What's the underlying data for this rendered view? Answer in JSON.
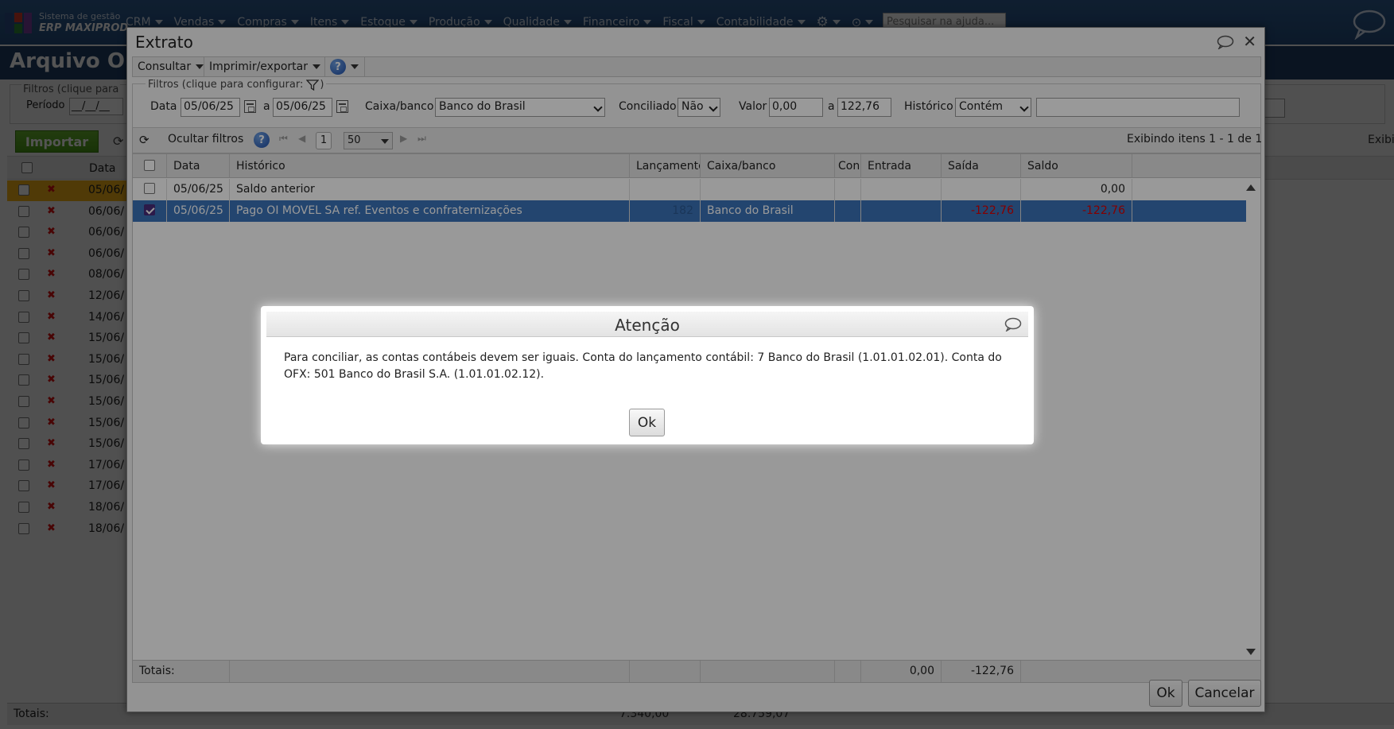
{
  "topbar": {
    "logo_line1": "Sistema de gestão",
    "logo_line2": "ERP MAXIPROD",
    "menu": [
      "CRM",
      "Vendas",
      "Compras",
      "Itens",
      "Estoque",
      "Produção",
      "Qualidade",
      "Financeiro",
      "Fiscal",
      "Contabilidade"
    ],
    "help_search_placeholder": "Pesquisar na ajuda..."
  },
  "background": {
    "page_title": "Arquivo OFX",
    "filter_legend": "Filtros (clique para",
    "periodo_label": "Período",
    "periodo_value": "__/__/__",
    "importar_label": "Importar",
    "exibi_text": "Exibi",
    "col_data": "Data",
    "rows": [
      {
        "date": "05/06/"
      },
      {
        "date": "06/06/"
      },
      {
        "date": "06/06/"
      },
      {
        "date": "06/06/"
      },
      {
        "date": "08/06/"
      },
      {
        "date": "12/06/"
      },
      {
        "date": "14/06/"
      },
      {
        "date": "15/06/"
      },
      {
        "date": "15/06/"
      },
      {
        "date": "15/06/"
      },
      {
        "date": "15/06/"
      },
      {
        "date": "15/06/"
      },
      {
        "date": "15/06/"
      },
      {
        "date": "17/06/"
      },
      {
        "date": "17/06/"
      },
      {
        "date": "18/06/"
      },
      {
        "date": "18/06/"
      }
    ],
    "totais_label": "Totais:",
    "totais_v1": "7.340,00",
    "totais_v2": "28.759,07"
  },
  "extrato": {
    "title": "Extrato",
    "toolbar": {
      "consultar": "Consultar",
      "imprimir": "Imprimir/exportar"
    },
    "filters": {
      "legend": "Filtros (clique para configurar:",
      "legend_end": ")",
      "data_label": "Data",
      "data_from": "05/06/25",
      "a_label": "a",
      "data_to": "05/06/25",
      "caixa_label": "Caixa/banco",
      "caixa_value": "Banco do Brasil",
      "conciliado_label": "Conciliado",
      "conciliado_value": "Não",
      "valor_label": "Valor",
      "valor_from": "0,00",
      "valor_to": "122,76",
      "historico_label": "Histórico",
      "historico_op": "Contém",
      "historico_value": ""
    },
    "gridbar": {
      "ocultar_filtros": "Ocultar filtros",
      "page": "1",
      "per_page": "50",
      "exibindo": "Exibindo itens 1 - 1 de 1"
    },
    "columns": [
      "Data",
      "Histórico",
      "Lançamento",
      "Caixa/banco",
      "Conc",
      "Entrada",
      "Saída",
      "Saldo"
    ],
    "rows": [
      {
        "data": "05/06/25",
        "historico": "Saldo anterior",
        "lancamento": "",
        "caixa": "",
        "entrada": "",
        "saida": "",
        "saldo": "0,00",
        "checked": false
      },
      {
        "data": "05/06/25",
        "historico": "Pago OI MOVEL SA ref. Eventos e confraternizações",
        "lancamento": "182",
        "caixa": "Banco do Brasil",
        "entrada": "",
        "saida": "-122,76",
        "saldo": "-122,76",
        "checked": true
      }
    ],
    "totais_label": "Totais:",
    "totais_entrada": "0,00",
    "totais_saida": "-122,76",
    "ok_label": "Ok",
    "cancel_label": "Cancelar"
  },
  "attention": {
    "title": "Atenção",
    "message": "Para conciliar, as contas contábeis devem ser iguais. Conta do lançamento contábil: 7 Banco do Brasil (1.01.01.02.01). Conta do OFX: 501 Banco do Brasil S.A. (1.01.01.02.12).",
    "ok_label": "Ok"
  },
  "colors": {
    "topbar": "#2f5e93",
    "selected_row": "#3b73b9",
    "negative": "#d00000",
    "import_green": "#5aa823",
    "highlight_row": "#f2b319"
  }
}
